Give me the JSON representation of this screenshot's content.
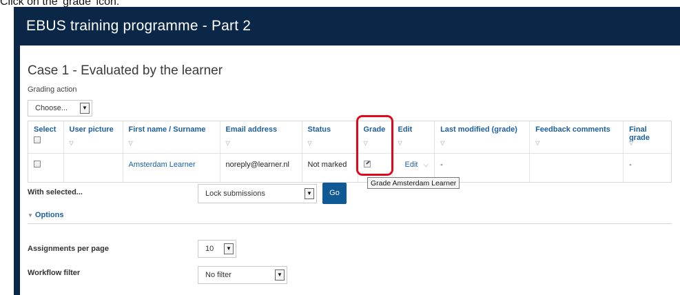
{
  "instruction": "Click on the 'grade' icon.",
  "banner": {
    "title": "EBUS training programme - Part 2"
  },
  "case": {
    "title": "Case 1 - Evaluated by the learner",
    "grading_action_label": "Grading action",
    "grading_action_value": "Choose..."
  },
  "table": {
    "headers": [
      "Select",
      "User picture",
      "First name / Surname",
      "Email address",
      "Status",
      "Grade",
      "Edit",
      "Last modified (grade)",
      "Feedback comments",
      "Final grade"
    ],
    "rows": [
      {
        "user_picture": "",
        "name": "Amsterdam Learner",
        "email": "noreply@learner.nl",
        "status": "Not marked",
        "edit": "Edit",
        "last_modified": "-",
        "feedback": "",
        "final_grade": "-"
      }
    ]
  },
  "tooltip": "Grade Amsterdam Learner",
  "with_selected": {
    "label": "With selected...",
    "value": "Lock submissions",
    "go_label": "Go"
  },
  "options": {
    "toggle_label": "Options",
    "assignments_per_page_label": "Assignments per page",
    "assignments_per_page_value": "10",
    "workflow_filter_label": "Workflow filter",
    "workflow_filter_value": "No filter"
  },
  "colors": {
    "banner_bg": "#0b2747",
    "link": "#1a5fa3",
    "highlight": "#e0081b",
    "go_button": "#0f5a94"
  }
}
